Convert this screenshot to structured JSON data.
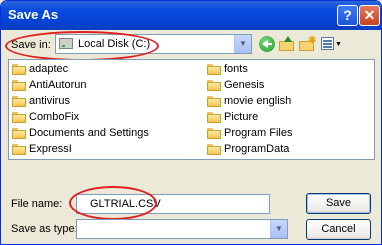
{
  "window": {
    "title": "Save As",
    "help_label": "?",
    "close_label": "✕"
  },
  "save_in": {
    "label": "Save in:",
    "value": "Local Disk (C:)"
  },
  "toolbar": {
    "icons": [
      "back-icon",
      "up-folder-icon",
      "new-folder-icon",
      "views-menu-icon"
    ]
  },
  "files": {
    "left": [
      "adaptec",
      "AntiAutorun",
      "antivirus",
      "ComboFix",
      "Documents and Settings",
      "ExpressI"
    ],
    "right": [
      "fonts",
      "Genesis",
      "movie english",
      "Picture",
      "Program Files",
      "ProgramData"
    ]
  },
  "file_name": {
    "label": "File name:",
    "value": "GLTRIAL.CSV"
  },
  "save_as_type": {
    "label": "Save as type:",
    "value": ""
  },
  "buttons": {
    "save": "Save",
    "cancel": "Cancel"
  },
  "colors": {
    "title_bar": "#0a4be0",
    "highlight_circle": "#e02020"
  }
}
